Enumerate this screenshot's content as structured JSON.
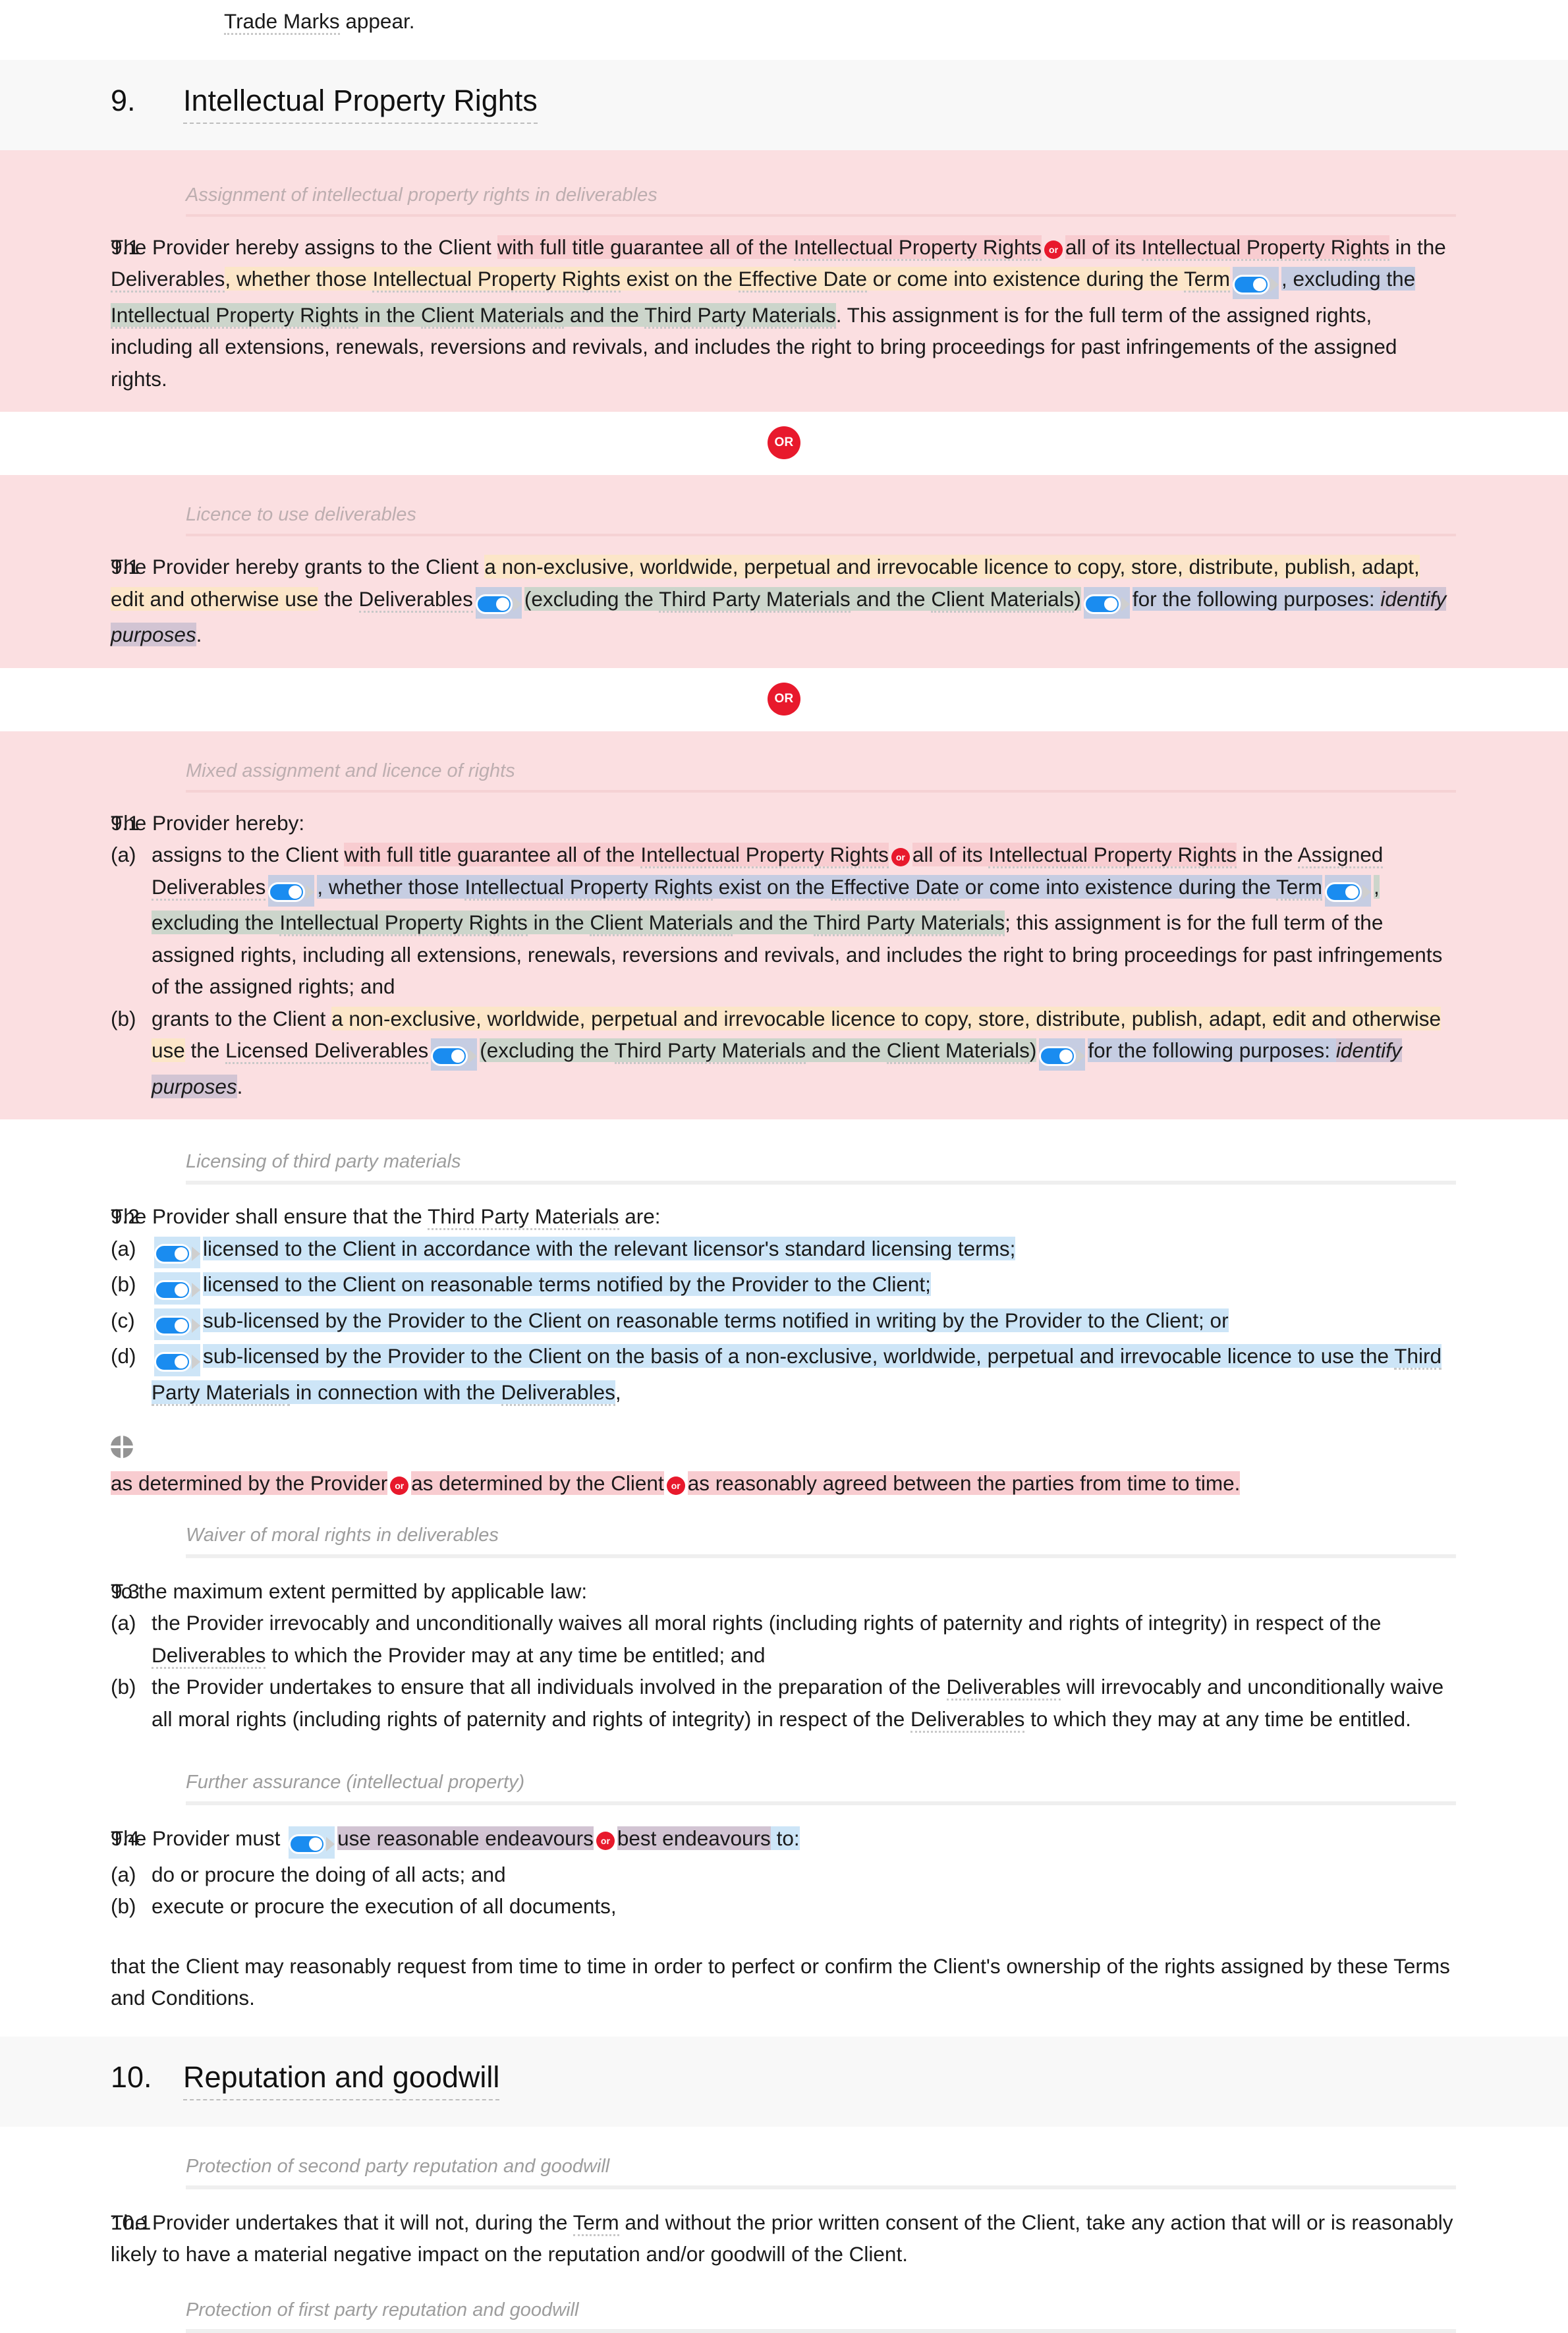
{
  "top_fragment": {
    "text_before": "Trade Marks",
    "text_after": " appear."
  },
  "sections": [
    {
      "number": "9.",
      "title": "Intellectual Property Rights"
    },
    {
      "number": "10.",
      "title": "Reputation and goodwill"
    }
  ],
  "subheadings": {
    "assignment": "Assignment of intellectual property rights in deliverables",
    "licence": "Licence to use deliverables",
    "mixed": "Mixed assignment and licence of rights",
    "licensing_tpm": "Licensing of third party materials",
    "waiver": "Waiver of moral rights in deliverables",
    "further_assurance": "Further assurance (intellectual property)",
    "protection_second": "Protection of second party reputation and goodwill",
    "protection_first": "Protection of first party reputation and goodwill"
  },
  "badges": {
    "or_big": "OR",
    "or_inline": "or"
  },
  "clause_9_1_a": {
    "number": "9.1",
    "t1": "The Provider hereby assigns to the Client ",
    "opt1": "with full title guarantee all of the ",
    "opt1_dt": "Intellectual Property Rights",
    "opt2": "all of its ",
    "opt2_dt": "Intellectual Property Rights",
    "t2": " in the ",
    "dt_deliverables": "Deliverables",
    "t3": ", whether those ",
    "dt_ipr": "Intellectual Property Rights",
    "t4": " exist on the ",
    "dt_effective": "Effective Date",
    "t5": " or come into existence during the ",
    "dt_term": "Term",
    "t6": ", excluding the ",
    "dt_ipr2": "Intellectual Property Rights",
    "t7": " in the ",
    "dt_client_mat": "Client Materials",
    "t8": " and the ",
    "dt_tpm": "Third Party Materials",
    "t9": ". This assignment is for the full term of the assigned rights, including all extensions, renewals, reversions and revivals, and includes the right to bring proceedings for past infringements of the assigned rights."
  },
  "clause_9_1_b": {
    "number": "9.1",
    "t1": "The Provider hereby grants to the Client ",
    "lic": "a non-exclusive, worldwide, perpetual and irrevocable licence to ",
    "acts": "copy, store, distribute, publish, adapt, edit and otherwise use",
    "t2": " the ",
    "dt_deliverables": "Deliverables",
    "t3": "(excluding the ",
    "dt_tpm": "Third Party Materials",
    "t4": " and the ",
    "dt_client_mat": "Client Materials",
    "t5": ")",
    "t6": "for the following purposes: ",
    "purposes": "identify purposes",
    "t7": "."
  },
  "clause_9_1_c": {
    "number": "9.1",
    "lead": "The Provider hereby:",
    "a": {
      "letter": "(a)",
      "t1": "assigns to the Client ",
      "opt1": "with full title guarantee all of the ",
      "opt1_dt": "Intellectual Property Rights",
      "opt2": "all of its ",
      "opt2_dt": "Intellectual Property Rights",
      "t2": " in the ",
      "dt_assigned": "Assigned Deliverables",
      "t3": ", whether those ",
      "dt_ipr": "Intellectual Property Rights",
      "t4": " exist on the ",
      "dt_effective": "Effective Date",
      "t5": " or come into existence during the ",
      "dt_term": "Term",
      "t6": ", excluding the ",
      "dt_ipr2": "Intellectual Property Rights",
      "t7": " in the ",
      "dt_client_mat": "Client Materials",
      "t8": " and the ",
      "dt_tpm": "Third Party Materials",
      "t9": "; this assignment is for the full term of the assigned rights, including all extensions, renewals, reversions and revivals, and includes the right to bring proceedings for past infringements of the assigned rights; and"
    },
    "b": {
      "letter": "(b)",
      "t1": "grants to the Client ",
      "lic": "a non-exclusive, worldwide, perpetual and irrevocable licence to ",
      "acts": "copy, store, distribute, publish, adapt, edit and otherwise use",
      "t2": " the ",
      "dt_licensed": "Licensed Deliverables",
      "t3": "(excluding the ",
      "dt_tpm": "Third Party Materials",
      "t4": " and the ",
      "dt_client_mat": "Client Materials",
      "t5": ")",
      "t6": "for the following purposes: ",
      "purposes": "identify purposes",
      "t7": "."
    }
  },
  "clause_9_2": {
    "number": "9.2",
    "lead_t1": "The Provider shall ensure that the ",
    "lead_dt": "Third Party Materials",
    "lead_t2": " are:",
    "items": [
      {
        "letter": "(a)",
        "text": "licensed to the Client in accordance with the relevant licensor's standard licensing terms;"
      },
      {
        "letter": "(b)",
        "text": "licensed to the Client on reasonable terms notified by the Provider to the Client;"
      },
      {
        "letter": "(c)",
        "text": "sub-licensed by the Provider to the Client on reasonable terms notified in writing by the Provider to the Client; or"
      }
    ],
    "item_d": {
      "letter": "(d)",
      "t1": "sub-licensed by the Provider to the Client on the basis of a non-exclusive, worldwide, perpetual and irrevocable licence to use the ",
      "dt_tpm": "Third Party Materials",
      "t2": " in connection with the ",
      "dt_deliverables": "Deliverables",
      "t3": ","
    },
    "tail": {
      "o1": "as determined by the Provider",
      "o2": "as determined by the Client",
      "o3": "as reasonably agreed between the parties from time to time."
    }
  },
  "clause_9_3": {
    "number": "9.3",
    "lead": "To the maximum extent permitted by applicable law:",
    "a": {
      "letter": "(a)",
      "t1": "the Provider irrevocably and unconditionally waives all moral rights (including rights of paternity and rights of integrity) in respect of the ",
      "dt": "Deliverables",
      "t2": " to which the Provider may at any time be entitled; and"
    },
    "b": {
      "letter": "(b)",
      "t1": "the Provider undertakes to ensure that all individuals involved in the preparation of the ",
      "dt1": "Deliverables",
      "t2": " will irrevocably and unconditionally waive all moral rights (including rights of paternity and rights of integrity) in respect of the ",
      "dt2": "Deliverables",
      "t3": " to which they may at any time be entitled."
    }
  },
  "clause_9_4": {
    "number": "9.4",
    "t1": "The Provider must ",
    "opt1": "use reasonable endeavours",
    "opt2": "best endeavours",
    "t2": " to:",
    "items": [
      {
        "letter": "(a)",
        "text": "do or procure the doing of all acts; and"
      },
      {
        "letter": "(b)",
        "text": "execute or procure the execution of all documents,"
      }
    ],
    "tail": "that the Client may reasonably request from time to time in order to perfect or confirm the Client's ownership of the rights assigned by these Terms and Conditions."
  },
  "clause_10_1": {
    "number": "10.1",
    "t1": "The Provider undertakes that it will not, during the ",
    "dt": "Term",
    "t2": " and without the prior written consent of the Client, take any action that will or is reasonably likely to have a material negative impact on the reputation and/or goodwill of the Client."
  },
  "colors": {
    "option_block_bg": "#fbdfe1",
    "section_band_bg": "#f8f8f8",
    "or_badge": "#e8192c",
    "toggle_on": "#1a8cf0",
    "hl_pink": "#f8ccd0",
    "hl_peach": "#fce6c8",
    "hl_lavender": "#c6cde2",
    "hl_green": "#ccd5cb",
    "hl_purple": "#d2c4d3",
    "hl_blue": "#cde5f7",
    "subhead_text": "#9d9d9d"
  }
}
